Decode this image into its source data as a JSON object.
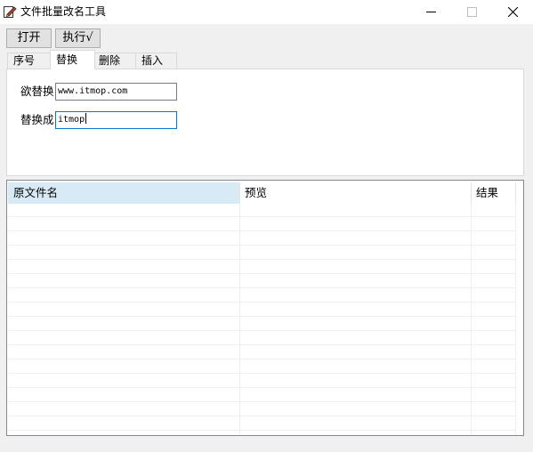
{
  "window": {
    "title": "文件批量改名工具",
    "icon": "edit-pencil-icon"
  },
  "toolbar": {
    "open_label": "打开",
    "execute_label": "执行√"
  },
  "tabs": [
    {
      "label": "序号",
      "active": false
    },
    {
      "label": "替换",
      "active": true
    },
    {
      "label": "删除",
      "active": false
    },
    {
      "label": "插入",
      "active": false
    }
  ],
  "replace": {
    "find_label": "欲替换",
    "find_value": "www.itmop.com",
    "replace_label": "替换成",
    "replace_value": "itmop"
  },
  "table": {
    "columns": [
      "原文件名",
      "预览",
      "结果"
    ],
    "rows": []
  },
  "colors": {
    "accent": "#0078d7",
    "selected_header": "#d9eaf7"
  }
}
